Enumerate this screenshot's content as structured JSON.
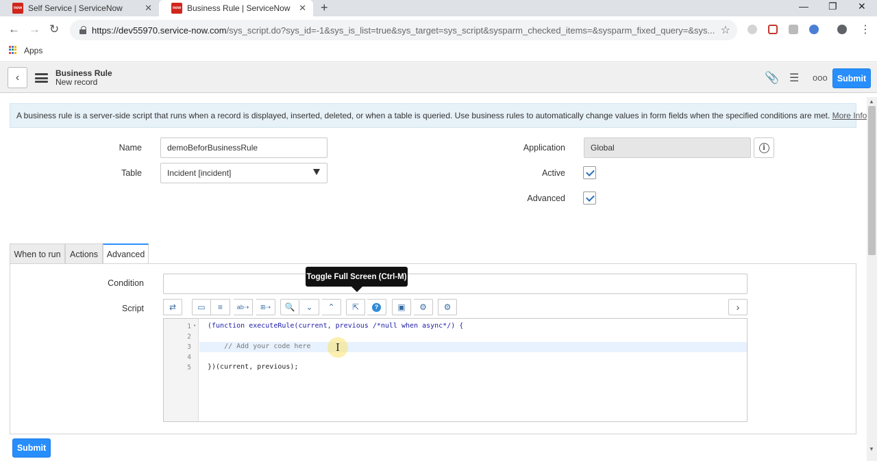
{
  "browser": {
    "tabs": [
      {
        "title": "Self Service | ServiceNow",
        "favicon": "now"
      },
      {
        "title": "Business Rule | ServiceNow",
        "favicon": "now"
      }
    ],
    "new_tab": "+",
    "url_host": "https://dev55970.service-now.com",
    "url_rest": "/sys_script.do?sys_id=-1&sys_is_list=true&sys_target=sys_script&sysparm_checked_items=&sysparm_fixed_query=&sys...",
    "bookmarks": [
      {
        "label": "Apps"
      }
    ],
    "window_controls": [
      "minimize",
      "restore",
      "close"
    ]
  },
  "header": {
    "title": "Business Rule",
    "subtitle": "New record",
    "submit_label": "Submit"
  },
  "info_banner": {
    "text": "A business rule is a server-side script that runs when a record is displayed, inserted, deleted, or when a table is queried. Use business rules to automatically change values in form fields when the specified conditions are met.",
    "link": "More Info"
  },
  "form": {
    "name_label": "Name",
    "name_value": "demoBeforBusinessRule",
    "table_label": "Table",
    "table_value": "Incident [incident]",
    "application_label": "Application",
    "application_value": "Global",
    "active_label": "Active",
    "active_checked": true,
    "advanced_label": "Advanced",
    "advanced_checked": true
  },
  "tabs": [
    {
      "label": "When to run",
      "active": false
    },
    {
      "label": "Actions",
      "active": false
    },
    {
      "label": "Advanced",
      "active": true
    }
  ],
  "advanced": {
    "condition_label": "Condition",
    "condition_value": "",
    "script_label": "Script",
    "tooltip": "Toggle Full Screen (Ctrl-M)",
    "toolbar_icons": [
      "format-code-icon",
      "comment-icon",
      "list-icon",
      "replace-icon",
      "replace-all-icon",
      "search-icon",
      "find-next-icon",
      "find-previous-icon",
      "fullscreen-icon",
      "help-icon",
      "save-icon",
      "script-debug-icon",
      "script-debugger-icon"
    ],
    "code_lines": [
      {
        "num": "1",
        "text": "(function executeRule(current, previous /*null when async*/) {"
      },
      {
        "num": "2",
        "text": ""
      },
      {
        "num": "3",
        "text": "    // Add your code here"
      },
      {
        "num": "4",
        "text": ""
      },
      {
        "num": "5",
        "text": "})(current, previous);"
      }
    ]
  },
  "footer": {
    "submit_label": "Submit"
  },
  "colors": {
    "accent": "#278efc",
    "info_bg": "#e7f1f8"
  }
}
